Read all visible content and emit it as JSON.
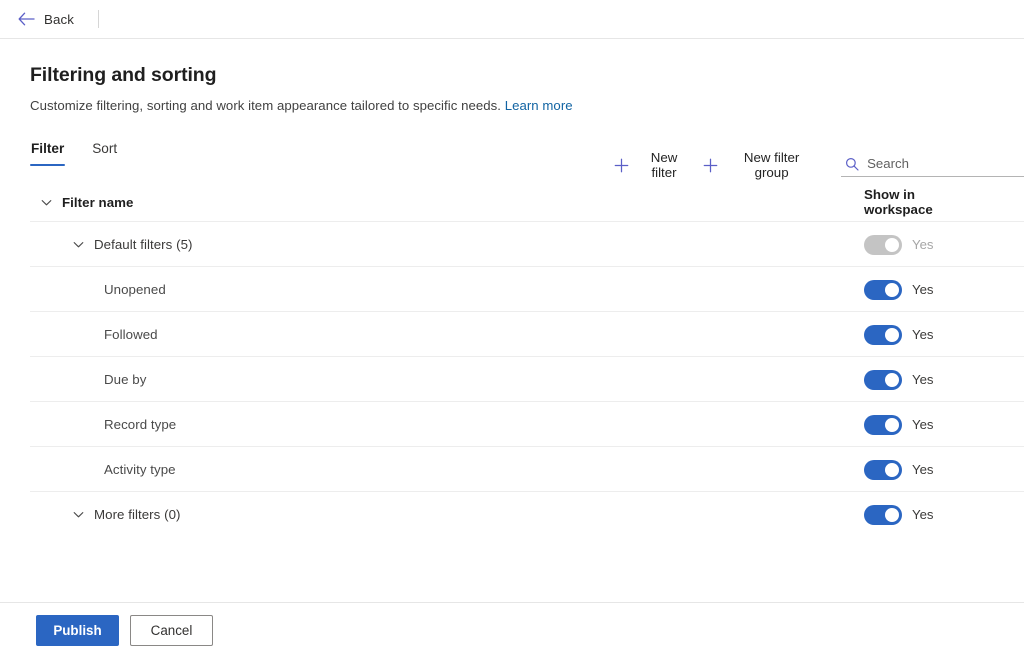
{
  "topbar": {
    "back_label": "Back",
    "back_icon": "arrow-left-icon"
  },
  "page": {
    "title": "Filtering and sorting",
    "subtitle": "Customize filtering, sorting and work item appearance tailored to specific needs.",
    "learn_more": "Learn more"
  },
  "tabs": [
    {
      "label": "Filter",
      "active": true
    },
    {
      "label": "Sort",
      "active": false
    }
  ],
  "toolbar": {
    "new_filter": "New filter",
    "new_filter_group": "New filter group",
    "plus_icon": "plus-icon",
    "search_icon": "search-icon",
    "search_placeholder": "Search",
    "search_value": ""
  },
  "table": {
    "columns": {
      "name": "Filter name",
      "toggle": "Show in workspace"
    },
    "rows": [
      {
        "label": "Default filters (5)",
        "indent": "group",
        "chevron": true,
        "toggle_on": true,
        "toggle_disabled": true,
        "toggle_label": "Yes"
      },
      {
        "label": "Unopened",
        "indent": "child",
        "chevron": false,
        "toggle_on": true,
        "toggle_disabled": false,
        "toggle_label": "Yes"
      },
      {
        "label": "Followed",
        "indent": "child",
        "chevron": false,
        "toggle_on": true,
        "toggle_disabled": false,
        "toggle_label": "Yes"
      },
      {
        "label": "Due by",
        "indent": "child",
        "chevron": false,
        "toggle_on": true,
        "toggle_disabled": false,
        "toggle_label": "Yes"
      },
      {
        "label": "Record type",
        "indent": "child",
        "chevron": false,
        "toggle_on": true,
        "toggle_disabled": false,
        "toggle_label": "Yes"
      },
      {
        "label": "Activity type",
        "indent": "child",
        "chevron": false,
        "toggle_on": true,
        "toggle_disabled": false,
        "toggle_label": "Yes"
      },
      {
        "label": "More filters (0)",
        "indent": "group",
        "chevron": true,
        "toggle_on": true,
        "toggle_disabled": false,
        "toggle_label": "Yes"
      }
    ]
  },
  "footer": {
    "publish": "Publish",
    "cancel": "Cancel"
  },
  "colors": {
    "accent": "#2b66c2",
    "link": "#1264a3",
    "icon_purple": "#5b5fc7",
    "toggle_on": "#2b66c2",
    "toggle_disabled": "#c4c4c4",
    "divider": "#ededed"
  }
}
